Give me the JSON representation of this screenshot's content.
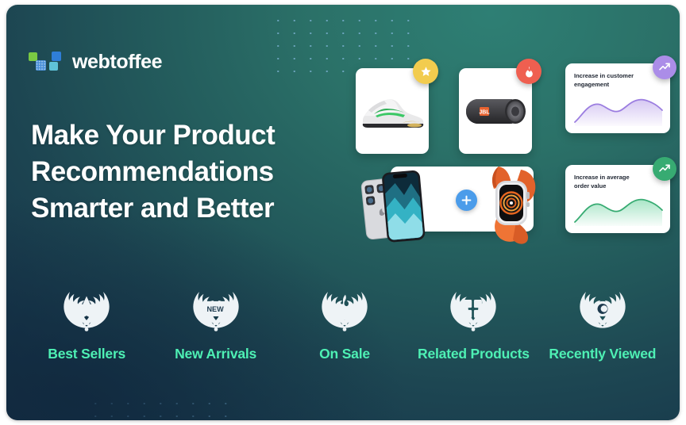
{
  "brand": {
    "name": "webtoffee",
    "logo_icon": "webtoffee-squares-logo",
    "colors": {
      "square_green": "#7ac943",
      "square_dotted_blue": "#4a90d9",
      "square_blue": "#2f7ed8",
      "square_cyan": "#5fc3d9"
    }
  },
  "headline": {
    "line1": "Make Your Product",
    "line2": "Recommendations",
    "line3": "Smarter and Better"
  },
  "theme": {
    "bg_teal": "#2e7f74",
    "bg_navy": "#13293e",
    "accent_mint": "#4ef0b4",
    "badge_star_yellow": "#f2cc4e",
    "badge_fire_red": "#ef5f50",
    "badge_trend_purple": "#ab8de8",
    "badge_trend_green": "#37ab72",
    "plus_blue": "#4b9cea"
  },
  "cards": {
    "shoe": {
      "name": "nike-sneaker-product-card",
      "badge_icon": "star-icon"
    },
    "speaker": {
      "name": "jbl-speaker-product-card",
      "badge_icon": "flame-icon"
    },
    "combo": {
      "name": "iphone-watch-bundle-card",
      "action_icon": "plus-icon"
    },
    "chart1": {
      "label_line1": "Increase in customer",
      "label_line2": "engagement",
      "badge_icon": "trending-up-icon",
      "color": "#9b7de0"
    },
    "chart2": {
      "label_line1": "Increase in average",
      "label_line2": "order value",
      "badge_icon": "trending-up-icon",
      "color": "#37ab72"
    }
  },
  "chart_data": [
    {
      "type": "area",
      "title": "Increase in customer engagement",
      "x": [
        0,
        1,
        2,
        3,
        4,
        5,
        6,
        7,
        8,
        9
      ],
      "values": [
        8,
        26,
        46,
        52,
        47,
        38,
        44,
        62,
        66,
        54
      ],
      "ylim": [
        0,
        70
      ],
      "xlabel": "",
      "ylabel": "",
      "grid": false,
      "legend": "none",
      "color": "#9b7de0"
    },
    {
      "type": "area",
      "title": "Increase in average order value",
      "x": [
        0,
        1,
        2,
        3,
        4,
        5,
        6,
        7,
        8,
        9
      ],
      "values": [
        8,
        26,
        46,
        52,
        47,
        38,
        44,
        62,
        66,
        54
      ],
      "ylim": [
        0,
        70
      ],
      "xlabel": "",
      "ylabel": "",
      "grid": false,
      "legend": "none",
      "color": "#37ab72"
    }
  ],
  "features": [
    {
      "label": "Best Sellers",
      "icon": "laurel-star-icon"
    },
    {
      "label": "New Arrivals",
      "icon": "laurel-new-ribbon-icon"
    },
    {
      "label": "On Sale",
      "icon": "laurel-flame-icon"
    },
    {
      "label": "Related Products",
      "icon": "laurel-grid-icon"
    },
    {
      "label": "Recently Viewed",
      "icon": "laurel-eye-icon"
    }
  ],
  "decor": {
    "dot_grid_top": "dot-grid-pattern",
    "dot_grid_bottom": "dot-grid-pattern"
  }
}
